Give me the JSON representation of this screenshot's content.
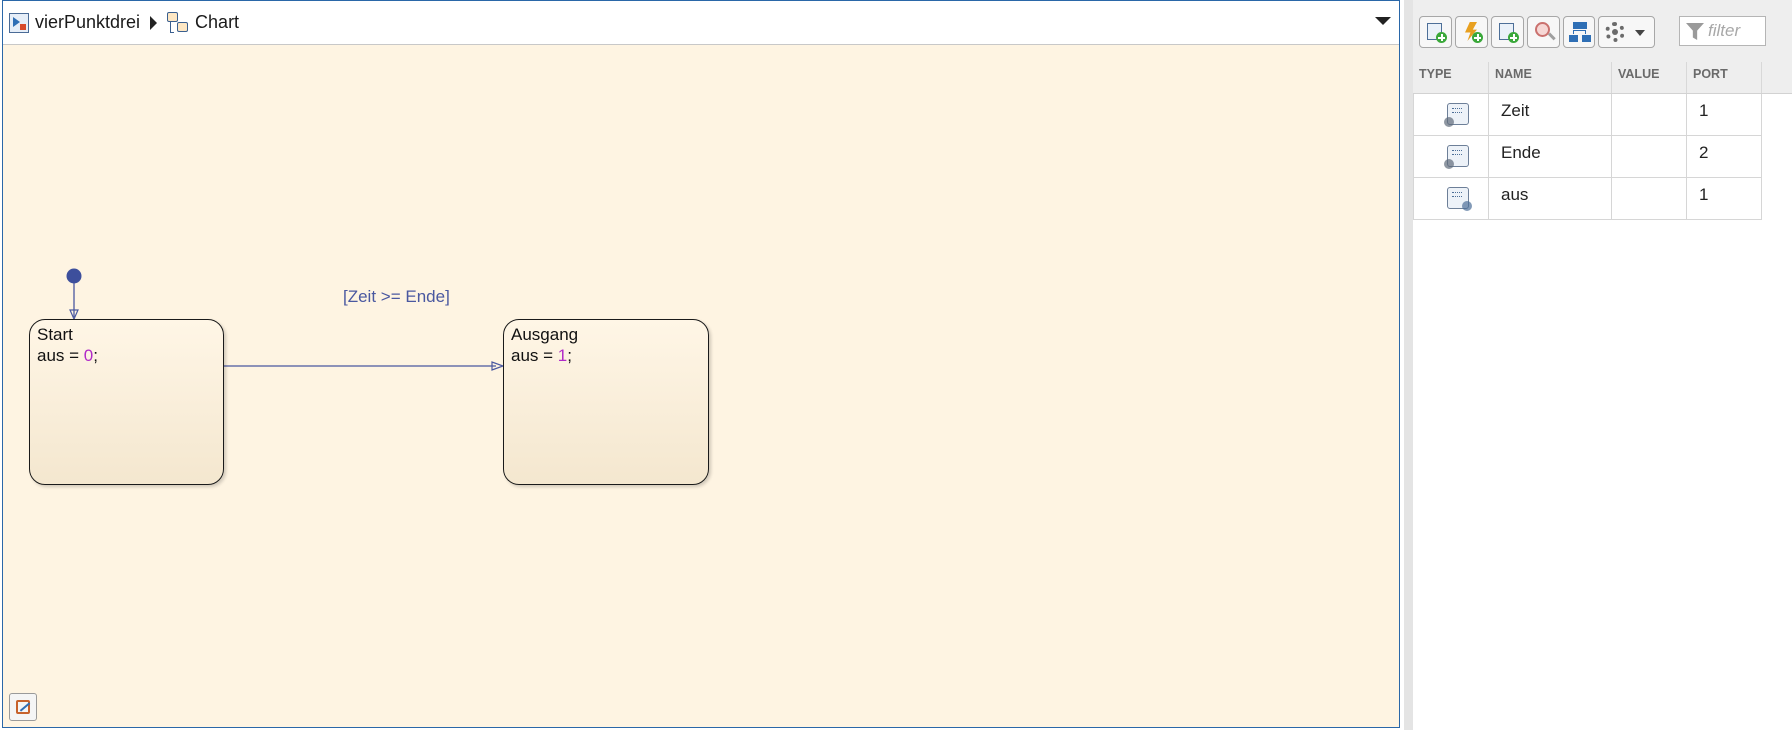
{
  "breadcrumb": {
    "model": "vierPunktdrei",
    "chart": "Chart"
  },
  "chart": {
    "states": [
      {
        "name": "Start",
        "action_prefix": "aus = ",
        "action_value": "0",
        "action_suffix": ";"
      },
      {
        "name": "Ausgang",
        "action_prefix": "aus = ",
        "action_value": "1",
        "action_suffix": ";"
      }
    ],
    "transition_label": "[Zeit >= Ende]"
  },
  "colors": {
    "canvas_bg": "#fef4e2",
    "transition": "#4a58a0",
    "numeric_literal": "#b02ac8",
    "default_transition_dot": "#3d4f9c"
  },
  "symbols_panel": {
    "toolbar_icons": [
      "add-data-icon",
      "add-event-icon",
      "add-message-icon",
      "resolve-undefined-icon",
      "hierarchy-icon",
      "settings-gear-icon"
    ],
    "filter_placeholder": "filter",
    "columns": [
      "TYPE",
      "NAME",
      "VALUE",
      "PORT"
    ],
    "rows": [
      {
        "type_icon": "input-data-icon",
        "name": "Zeit",
        "value": "",
        "port": "1"
      },
      {
        "type_icon": "input-data-icon",
        "name": "Ende",
        "value": "",
        "port": "2"
      },
      {
        "type_icon": "output-data-icon",
        "name": "aus",
        "value": "",
        "port": "1"
      }
    ]
  }
}
